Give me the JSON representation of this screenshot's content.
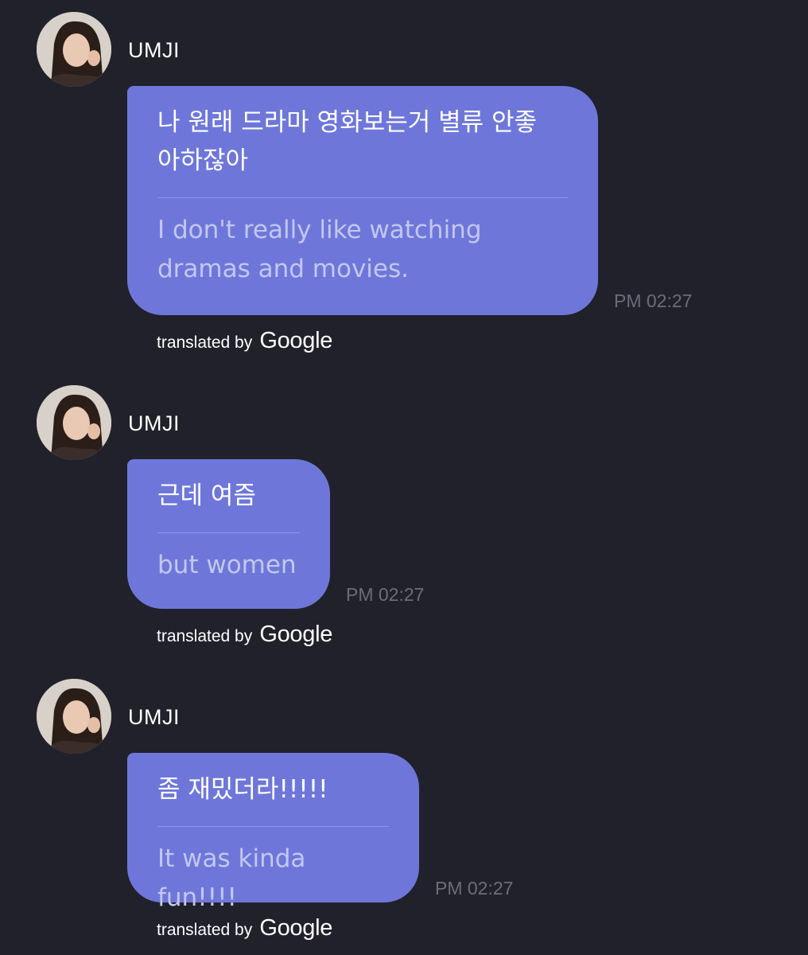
{
  "messages": [
    {
      "sender": "UMJI",
      "original": "나 원래 드라마 영화보는거 별류 안좋\n아하잖아",
      "translation": "I don't really like watching\ndramas and movies.",
      "time": "PM 02:27",
      "attribution": {
        "prefix": "translated by",
        "brand": "Google"
      }
    },
    {
      "sender": "UMJI",
      "original": "근데 여즘",
      "translation": "but women",
      "time": "PM 02:27",
      "attribution": {
        "prefix": "translated by",
        "brand": "Google"
      }
    },
    {
      "sender": "UMJI",
      "original": "좀 재밌더라!!!!!",
      "translation": "It was kinda fun!!!!",
      "time": "PM 02:27",
      "attribution": {
        "prefix": "translated by",
        "brand": "Google"
      }
    }
  ],
  "colors": {
    "background": "#21212b",
    "bubble": "#6e77d9",
    "translation_text": "#c3c7f0",
    "timestamp": "#6c6c7a"
  }
}
